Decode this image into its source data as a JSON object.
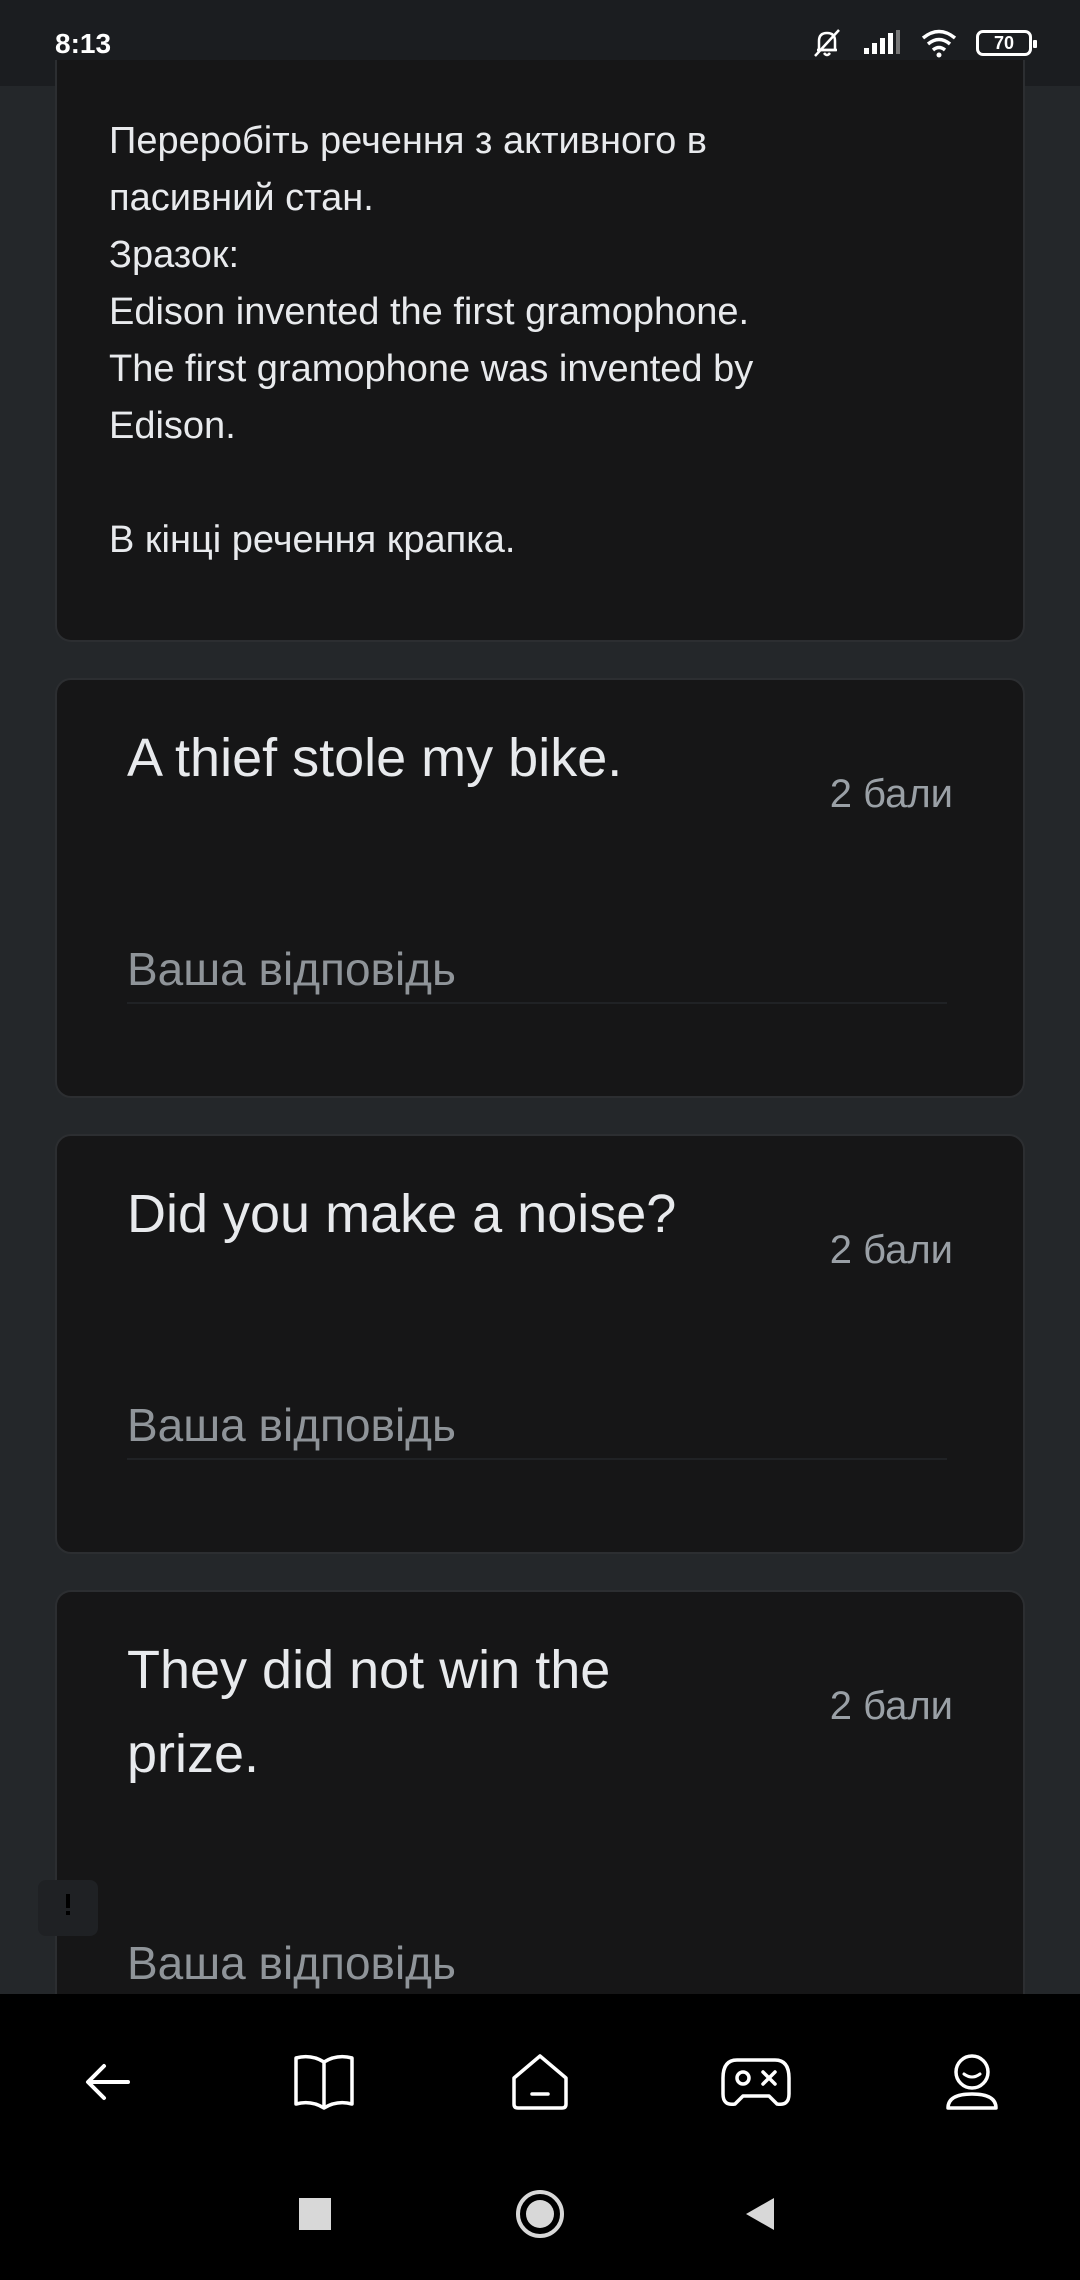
{
  "status": {
    "time": "8:13",
    "battery": "70",
    "icons": [
      "bell-off-icon",
      "signal-icon",
      "wifi-icon",
      "battery-icon"
    ]
  },
  "instructions": {
    "lines": [
      "Переробіть речення з активного в",
      "пасивний стан.",
      "Зразок:",
      "Edison invented the first gramophone.",
      "The first gramophone was invented by",
      "Edison.",
      "В кінці речення крапка."
    ]
  },
  "questions": [
    {
      "title_lines": [
        "A thief stole my bike."
      ],
      "points": "2 бали",
      "placeholder": "Ваша відповідь"
    },
    {
      "title_lines": [
        "Did you make a noise?"
      ],
      "points": "2 бали",
      "placeholder": "Ваша відповідь"
    },
    {
      "title_lines": [
        "They did not win the",
        "prize."
      ],
      "points": "2 бали",
      "placeholder": "Ваша відповідь"
    }
  ],
  "bottom_nav": {
    "items": [
      "back-arrow-icon",
      "book-icon",
      "home-icon",
      "gamepad-icon",
      "profile-icon"
    ]
  },
  "system_nav": {
    "items": [
      "recents-square-icon",
      "home-circle-icon",
      "back-triangle-icon"
    ]
  },
  "colors": {
    "background": "#24272a",
    "card": "#161617",
    "text": "#e8eaed",
    "muted": "#9aa0a6"
  }
}
